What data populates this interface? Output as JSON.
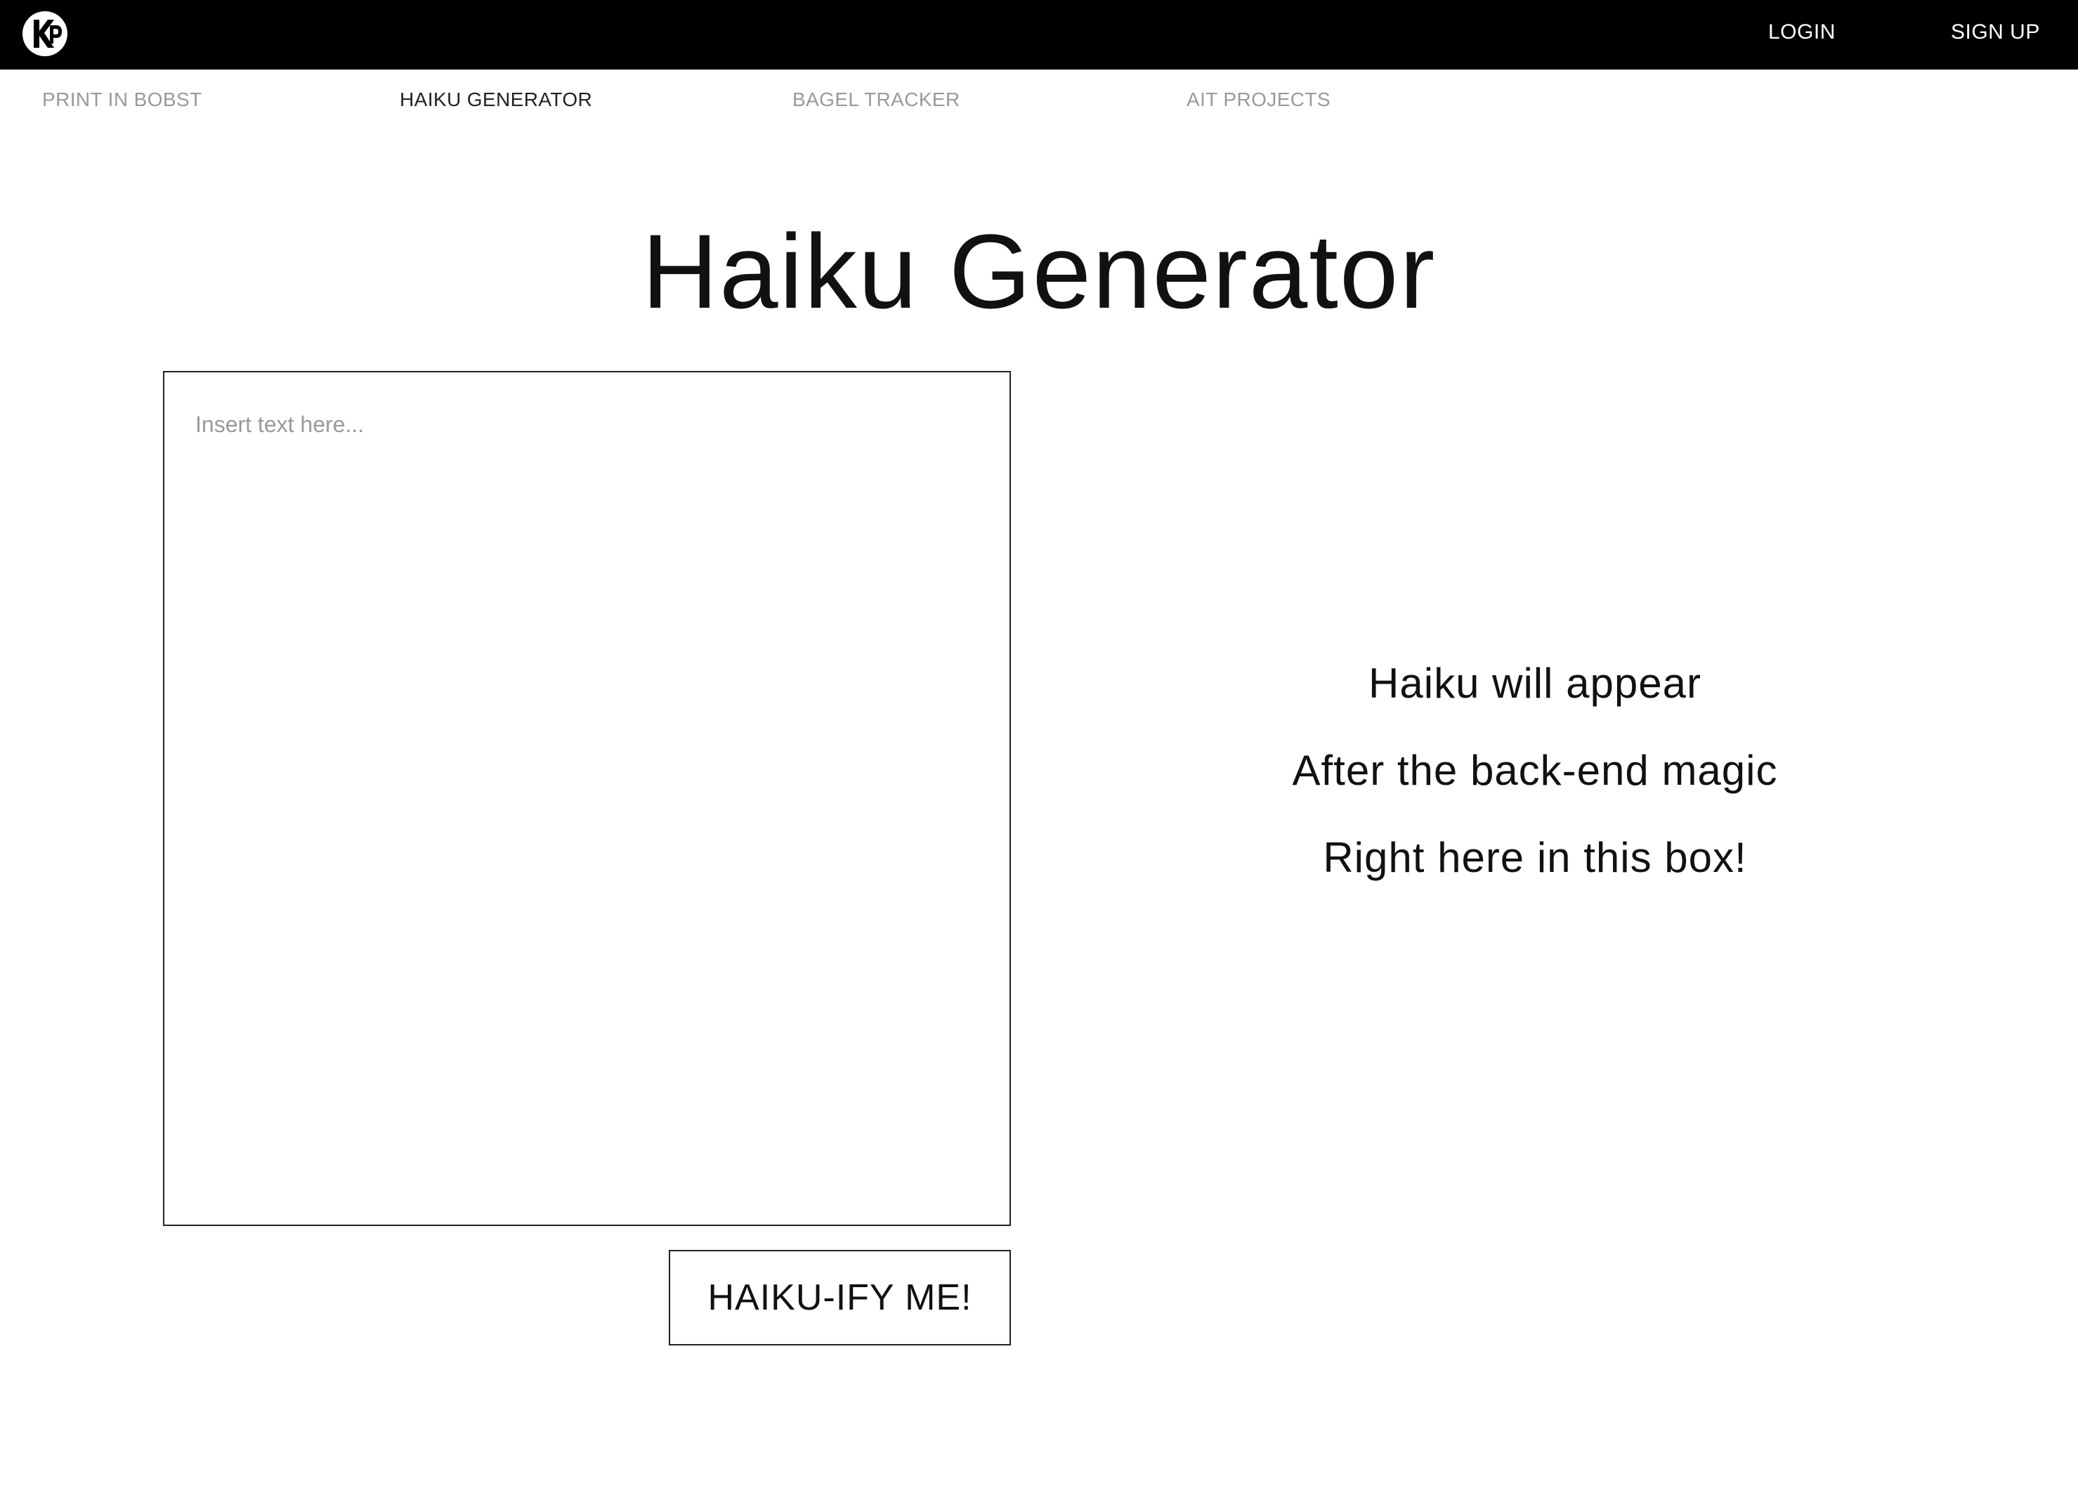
{
  "header": {
    "logo_icon": "kp-logo-icon",
    "login_label": "LOGIN",
    "signup_label": "SIGN UP"
  },
  "nav": {
    "items": [
      {
        "label": "PRINT IN BOBST",
        "active": false
      },
      {
        "label": "HAIKU GENERATOR",
        "active": true
      },
      {
        "label": "BAGEL TRACKER",
        "active": false
      },
      {
        "label": "AIT PROJECTS",
        "active": false
      }
    ]
  },
  "main": {
    "title": "Haiku Generator",
    "input": {
      "placeholder": "Insert text here...",
      "value": ""
    },
    "button_label": "HAIKU-IFY ME!",
    "haiku_lines": [
      "Haiku will appear",
      "After the back-end magic",
      "Right here in this box!"
    ]
  },
  "colors": {
    "topbar": "#000000",
    "inactive_nav": "#9a9a9a",
    "active_nav": "#222222",
    "text": "#111111"
  }
}
